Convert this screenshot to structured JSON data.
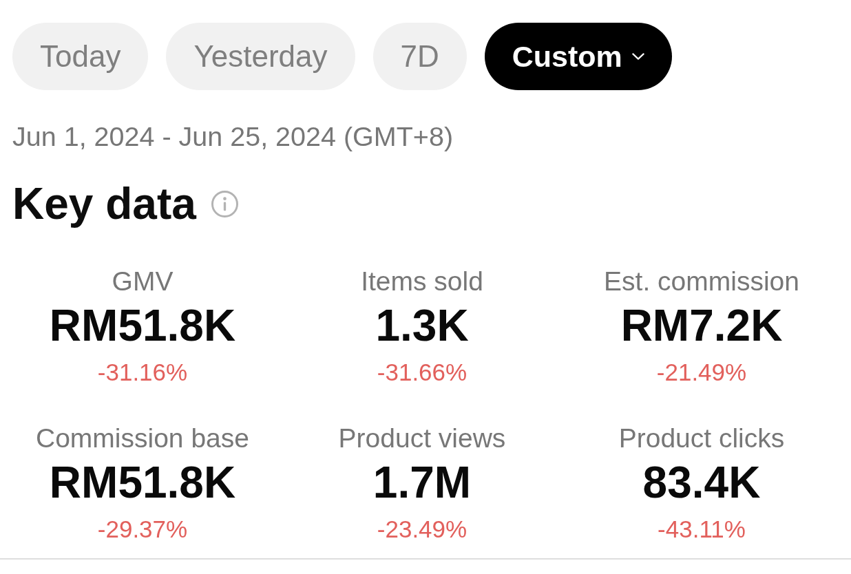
{
  "date_range_tabs": [
    {
      "label": "Today",
      "selected": false,
      "dropdown": false
    },
    {
      "label": "Yesterday",
      "selected": false,
      "dropdown": false
    },
    {
      "label": "7D",
      "selected": false,
      "dropdown": false
    },
    {
      "label": "Custom",
      "selected": true,
      "dropdown": true
    }
  ],
  "date_range": "Jun 1, 2024 - Jun 25, 2024 (GMT+8)",
  "key_data": {
    "title": "Key data",
    "metrics": [
      {
        "label": "GMV",
        "value": "RM51.8K",
        "change": "-31.16%",
        "decreased": true
      },
      {
        "label": "Items sold",
        "value": "1.3K",
        "change": "-31.66%",
        "decreased": true
      },
      {
        "label": "Est. commission",
        "value": "RM7.2K",
        "change": "-21.49%",
        "decreased": true
      },
      {
        "label": "Commission base",
        "value": "RM51.8K",
        "change": "-29.37%",
        "decreased": true
      },
      {
        "label": "Product views",
        "value": "1.7M",
        "change": "-23.49%",
        "decreased": true
      },
      {
        "label": "Product clicks",
        "value": "83.4K",
        "change": "-43.11%",
        "decreased": true
      }
    ]
  }
}
